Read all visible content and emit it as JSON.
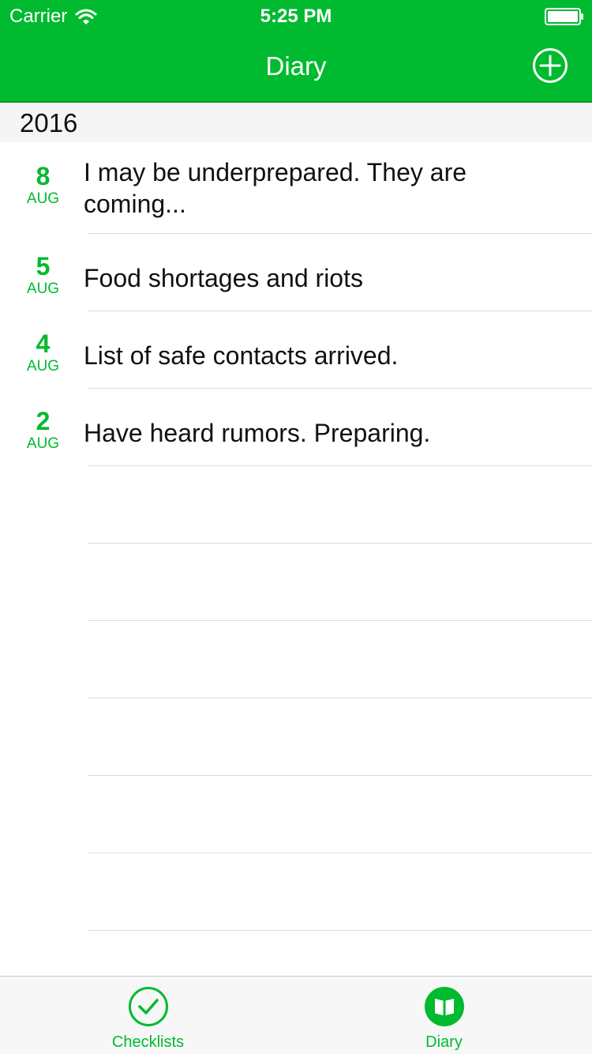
{
  "status_bar": {
    "carrier": "Carrier",
    "time": "5:25 PM"
  },
  "nav": {
    "title": "Diary",
    "add_icon": "plus-circle-icon"
  },
  "section": {
    "title": "2016"
  },
  "entries": [
    {
      "day": "8",
      "month": "AUG",
      "text": "I may be underprepared. They are coming..."
    },
    {
      "day": "5",
      "month": "AUG",
      "text": "Food shortages and riots"
    },
    {
      "day": "4",
      "month": "AUG",
      "text": "List of safe contacts arrived."
    },
    {
      "day": "2",
      "month": "AUG",
      "text": "Have heard rumors. Preparing."
    }
  ],
  "tabs": [
    {
      "label": "Checklists",
      "icon": "checkmark-circle-icon",
      "selected": false
    },
    {
      "label": "Diary",
      "icon": "open-book-icon",
      "selected": true
    }
  ],
  "colors": {
    "accent": "#00ba2f",
    "section_background": "#f5f5f5",
    "tabbar_background": "#f7f7f7"
  }
}
